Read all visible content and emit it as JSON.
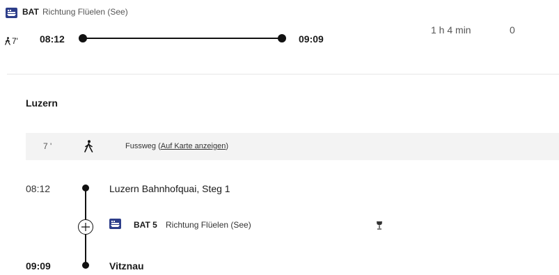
{
  "summary": {
    "mode_label": "BAT",
    "direction": "Richtung Flüelen (See)",
    "walk_minutes": "7'",
    "departure_time": "08:12",
    "arrival_time": "09:09",
    "duration": "1 h 4 min",
    "changes": "0"
  },
  "detail": {
    "origin_station": "Luzern",
    "walk": {
      "minutes": "7 '",
      "label": "Fussweg (",
      "link": "Auf Karte anzeigen",
      "suffix": ")"
    },
    "departure_time": "08:12",
    "departure_stop": "Luzern Bahnhofquai, Steg 1",
    "line_label": "BAT 5",
    "line_direction": "Richtung Flüelen (See)",
    "arrival_time": "09:09",
    "arrival_stop": "Vitznau"
  },
  "icons": {
    "ship": "ship-icon",
    "walk": "walk-icon",
    "restaurant": "wine-glass-icon",
    "expand": "plus-icon"
  },
  "colors": {
    "ship_badge": "#2d3e8a",
    "walk_band": "#f3f3f3",
    "divider": "#e6e6e6"
  }
}
